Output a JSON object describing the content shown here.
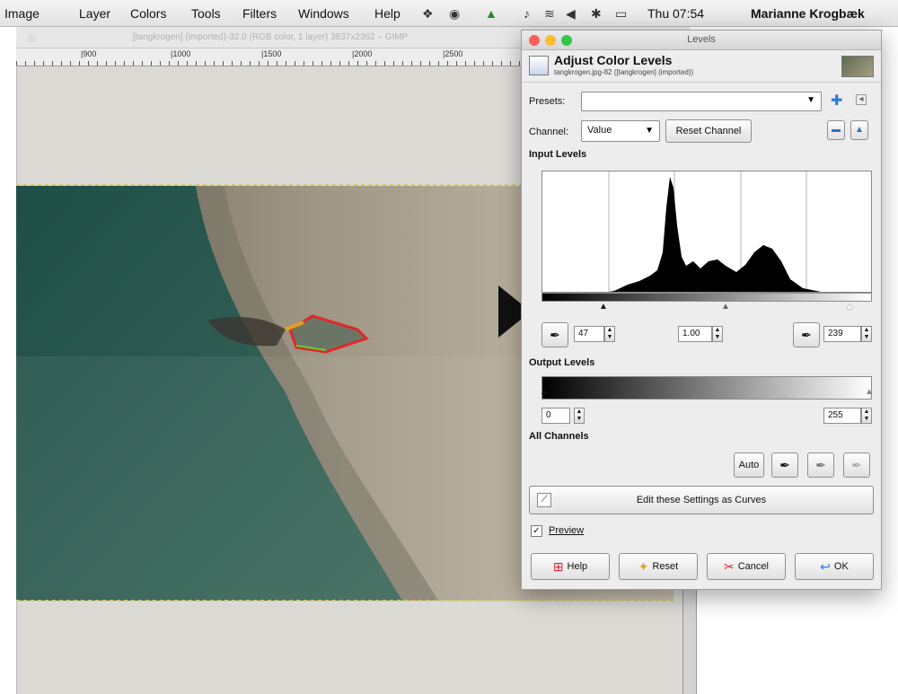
{
  "menubar": {
    "items": [
      "Image",
      "Layer",
      "Colors",
      "Tools",
      "Filters",
      "Windows",
      "Help"
    ],
    "clock": "Thu 07:54",
    "user": "Marianne Krogbæk"
  },
  "canvas": {
    "title": "[tangkrogen] (imported)-32.0 (RGB color, 1 layer) 3837x2362 – GIMP",
    "ruler_labels": [
      "|900",
      "|1000",
      "|1500",
      "|2000",
      "|2500"
    ]
  },
  "dialog": {
    "window_title": "Levels",
    "header_title": "Adjust Color Levels",
    "header_subtitle": "tangkrogen.jpg-82 ([tangkrogen] (imported))",
    "presets_label": "Presets:",
    "presets_value": "",
    "channel_label": "Channel:",
    "channel_value": "Value",
    "reset_channel": "Reset Channel",
    "input_levels_label": "Input Levels",
    "input_low": "47",
    "input_gamma": "1.00",
    "input_high": "239",
    "output_levels_label": "Output Levels",
    "output_low": "0",
    "output_high": "255",
    "all_channels_label": "All Channels",
    "auto_label": "Auto",
    "edit_curves_label": "Edit these Settings as Curves",
    "preview_label": "Preview",
    "preview_checked": "✓",
    "help_label": "Help",
    "reset_label": "Reset",
    "cancel_label": "Cancel",
    "ok_label": "OK"
  },
  "colors": {
    "close": "#fc5f57",
    "minimize": "#fdbc2e",
    "zoom": "#33c748",
    "sea": "#2f5a4f",
    "sand": "#a39a86"
  }
}
